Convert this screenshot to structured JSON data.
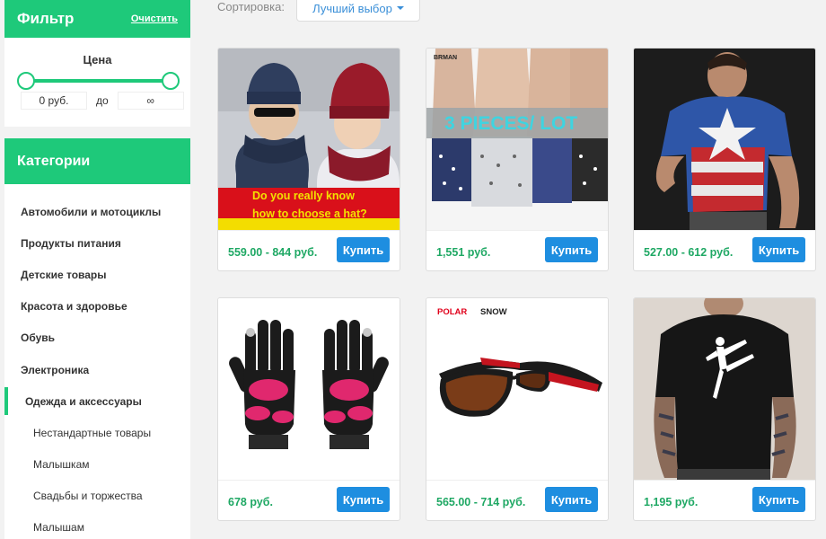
{
  "filter": {
    "title": "Фильтр",
    "clear_label": "Очистить",
    "price_title": "Цена",
    "price_from": "0 руб.",
    "price_sep": "до",
    "price_to": "∞",
    "range": [
      0,
      1
    ]
  },
  "categories": {
    "title": "Категории",
    "items": [
      {
        "label": "Автомобили и мотоциклы"
      },
      {
        "label": "Продукты питания"
      },
      {
        "label": "Детские товары"
      },
      {
        "label": "Красота и здоровье"
      },
      {
        "label": "Обувь"
      },
      {
        "label": "Электроника"
      },
      {
        "label": "Одежда и аксессуары",
        "active": true
      },
      {
        "label": "Нестандартные товары",
        "sub": true
      },
      {
        "label": "Малышкам",
        "sub": true
      },
      {
        "label": "Свадьбы и торжества",
        "sub": true
      },
      {
        "label": "Малышам",
        "sub": true
      }
    ]
  },
  "sort": {
    "label": "Сортировка:",
    "value": "Лучший выбор"
  },
  "products": [
    {
      "price": "559.00 - 844 руб.",
      "buy": "Купить",
      "banner_line1": "Do you really know",
      "banner_line2": "how to choose a hat?"
    },
    {
      "price": "1,551 руб.",
      "buy": "Купить",
      "banner": "3 PIECES/ LOT",
      "brand": "BRMAN"
    },
    {
      "price": "527.00 - 612 руб.",
      "buy": "Купить"
    },
    {
      "price": "678 руб.",
      "buy": "Купить"
    },
    {
      "price": "565.00 - 714 руб.",
      "buy": "Купить",
      "brand_a": "POLAR",
      "brand_b": "SNOW"
    },
    {
      "price": "1,195 руб.",
      "buy": "Купить"
    }
  ],
  "colors": {
    "accent": "#1ec97a",
    "buy_button": "#1e8ee0",
    "price": "#1fa864"
  }
}
